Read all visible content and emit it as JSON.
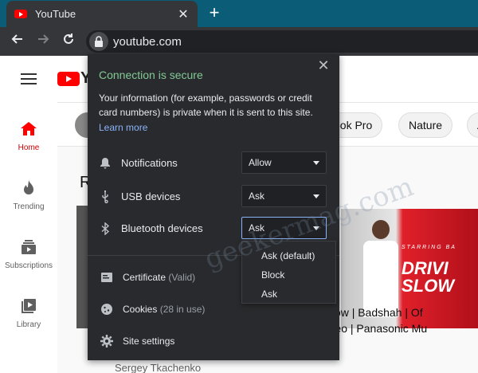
{
  "browser": {
    "tab_title": "YouTube",
    "tab_close": "✕",
    "new_tab": "+",
    "url": "youtube.com"
  },
  "youtube": {
    "logo_text": "Yo",
    "sidebar": [
      {
        "label": "Home",
        "icon": "home-icon",
        "active": true
      },
      {
        "label": "Trending",
        "icon": "flame-icon"
      },
      {
        "label": "Subscriptions",
        "icon": "subscriptions-icon"
      },
      {
        "label": "Library",
        "icon": "library-icon"
      }
    ],
    "chips": [
      "ook Pro",
      "Nature",
      "A"
    ],
    "section_label": "R",
    "video_title": "Driving Slow | Badshah | Of Music Video | Panasonic Mu",
    "video_title_line1": "Driving Slow | Badshah | Of",
    "video_title_line2": "Music Video | Panasonic Mu",
    "thumb_text_small": "STARRING BA",
    "thumb_text_big1": "DRIVI",
    "thumb_text_big2": "SLOW",
    "channel": "Sergey Tkachenko"
  },
  "popup": {
    "close": "✕",
    "title": "Connection is secure",
    "description": "Your information (for example, passwords or credit card numbers) is private when it is sent to this site.",
    "learn_more": "Learn more",
    "permissions": [
      {
        "label": "Notifications",
        "icon": "bell-icon",
        "value": "Allow"
      },
      {
        "label": "USB devices",
        "icon": "usb-icon",
        "value": "Ask"
      },
      {
        "label": "Bluetooth devices",
        "icon": "bluetooth-icon",
        "value": "Ask",
        "active": true
      }
    ],
    "dropdown_options": [
      "Ask (default)",
      "Block",
      "Ask"
    ],
    "links": [
      {
        "label": "Certificate",
        "sub": "(Valid)",
        "icon": "certificate-icon"
      },
      {
        "label": "Cookies",
        "sub": "(28 in use)",
        "icon": "cookie-icon"
      },
      {
        "label": "Site settings",
        "sub": "",
        "icon": "gear-icon"
      }
    ]
  },
  "watermark": "geekermag.com",
  "colors": {
    "secure_green": "#81c995",
    "link_blue": "#8ab4f8",
    "youtube_red": "#ff0000",
    "popup_bg": "#292a2d"
  }
}
